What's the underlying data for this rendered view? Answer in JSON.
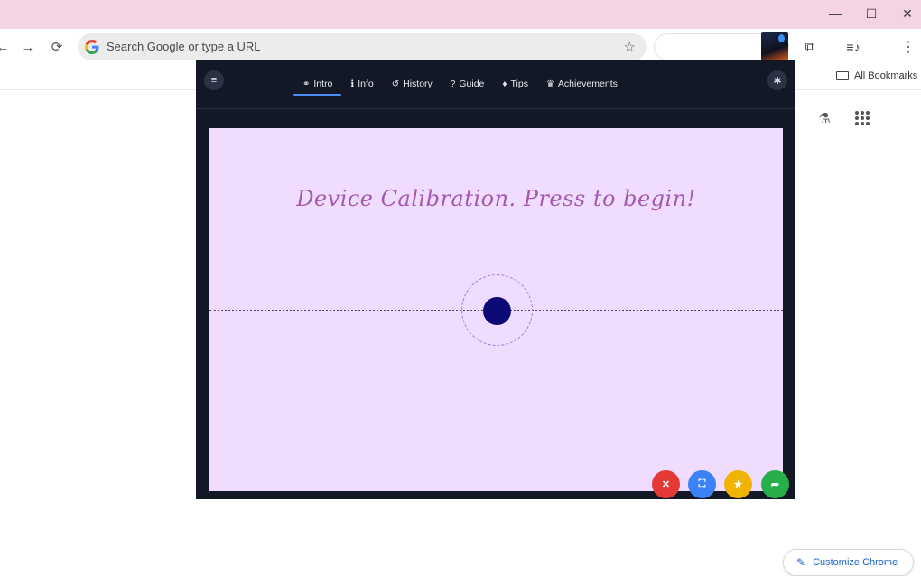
{
  "browser": {
    "window_controls": [
      "—",
      "☐",
      "✕"
    ],
    "nav": {
      "back": "←",
      "forward": "→",
      "reload": "⟳"
    },
    "omnibox": {
      "placeholder": "Search Google or type a URL",
      "star": "☆"
    },
    "toolbar_icons": {
      "extensions": "⧉",
      "media": "≡♪",
      "menu": "⋮"
    },
    "bookmarks_bar": {
      "all_bookmarks_label": "All Bookmarks"
    },
    "ntp": {
      "customize_label": "Customize Chrome",
      "customize_icon": "✎",
      "flask_icon": "⚗"
    },
    "colors": {
      "titlebar": "#f4d3e3",
      "omnibox": "#ececec",
      "link": "#1a62c8"
    }
  },
  "popup": {
    "menu_icon": "≡",
    "settings_icon": "✱",
    "tabs": [
      {
        "icon": "⚭",
        "label": "Intro"
      },
      {
        "icon": "ℹ",
        "label": "Info"
      },
      {
        "icon": "↺",
        "label": "History"
      },
      {
        "icon": "?",
        "label": "Guide"
      },
      {
        "icon": "♦",
        "label": "Tips"
      },
      {
        "icon": "♛",
        "label": "Achievements"
      }
    ],
    "active_tab": "Intro",
    "stage": {
      "prompt": "Device Calibration. Press to begin!",
      "background": "#f0dcfe",
      "target_color": "#0d0a78"
    },
    "fabs": [
      {
        "icon": "✕",
        "color": "#e53935"
      },
      {
        "icon": "⛶",
        "color": "#3b82f6"
      },
      {
        "icon": "★",
        "color": "#f0b400"
      },
      {
        "icon": "➦",
        "color": "#27b04a"
      }
    ],
    "colors": {
      "panel": "#121826",
      "active_underline": "#4d8cf0"
    }
  }
}
